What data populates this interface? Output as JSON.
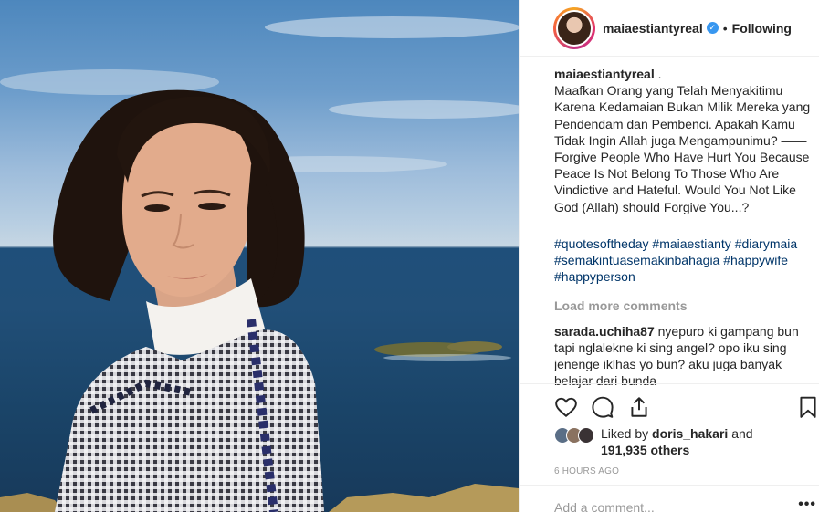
{
  "post": {
    "username": "maiaestiantyreal",
    "follow_status": "Following",
    "separator": "•"
  },
  "caption": {
    "username": "maiaestiantyreal",
    "suffix": " .",
    "text": "Maafkan Orang yang Telah Menyakitimu Karena Kedamaian Bukan Milik Mereka yang Pendendam dan Pembenci. Apakah Kamu Tidak Ingin Allah juga Mengampunimu? ——\nForgive People Who Have Hurt You Because Peace Is Not Belong To Those Who Are Vindictive and Hateful. Would You Not Like God (Allah) should Forgive You...?\n——",
    "hashtags": [
      "#quotesoftheday",
      "#maiaestianty",
      "#diarymaia",
      "#semakintuasemakinbahagia",
      "#happywife",
      "#happyperson"
    ]
  },
  "load_more": "Load more comments",
  "comment": {
    "username": "sarada.uchiha87",
    "text": "nyepuro ki gampang bun tapi nglalekne ki sing angel? opo iku sing jenenge iklhas yo bun? aku juga banyak belajar dari bunda"
  },
  "likes": {
    "prefix": "Liked by",
    "user": "doris_hakari",
    "and": "and",
    "count": "191,935 others"
  },
  "timestamp": "6 HOURS AGO",
  "add_comment_placeholder": "Add a comment...",
  "more_label": "•••",
  "icons": {
    "verified": "verified-badge-icon",
    "like": "heart-icon",
    "comment": "comment-bubble-icon",
    "share": "share-icon",
    "save": "bookmark-icon"
  },
  "colors": {
    "verified": "#3897f0",
    "hashtag": "#003569",
    "muted": "#999999",
    "text": "#262626"
  }
}
